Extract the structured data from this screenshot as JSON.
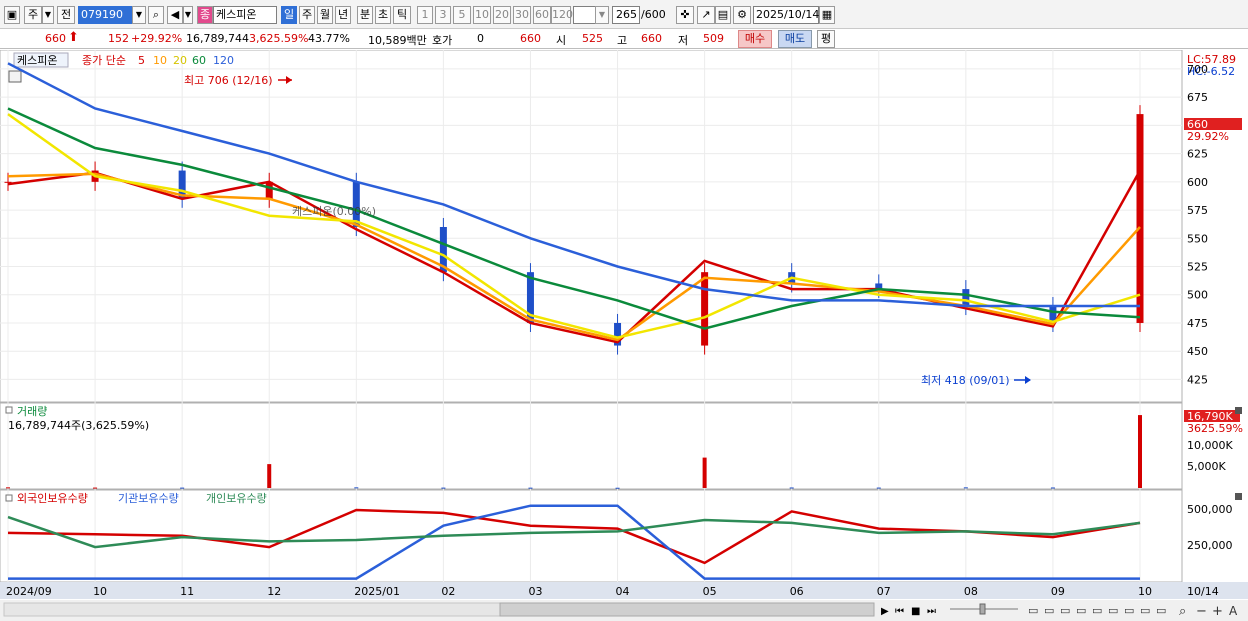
{
  "toolbar": {
    "period_label": "주",
    "prev_label": "전",
    "code_value": "079190",
    "badge_label": "종",
    "stock_name": "케스피온",
    "periods": [
      "일",
      "주",
      "월",
      "년",
      "분",
      "초",
      "틱"
    ],
    "numbers": [
      "1",
      "3",
      "5",
      "10",
      "20",
      "30",
      "60",
      "120"
    ],
    "count_value": "265",
    "count_total": "/600",
    "date_value": "2025/10/14"
  },
  "quote": {
    "price": "660",
    "change": "152",
    "change_pct": "+29.92%",
    "volume": "16,789,744",
    "volume_pct": "3,625.59%",
    "turnover_pct": "43.77%",
    "amount": "10,589백만",
    "hoga_label": "호가",
    "hoga_value": "0",
    "hoga_price": "660",
    "open_label": "시",
    "open_value": "525",
    "high_label": "고",
    "high_value": "660",
    "low_label": "저",
    "low_value": "509",
    "buy_label": "매수",
    "sell_label": "매도",
    "avg_label": "평"
  },
  "price_pane": {
    "name": "케스피온",
    "ma_title": "종가 단순",
    "ma_periods": [
      "5",
      "10",
      "20",
      "60",
      "120"
    ],
    "ma_colors": [
      "#d40000",
      "#ff9a00",
      "#f2e600",
      "#0b8a3b",
      "#2b5fd9"
    ],
    "lc_label": "LC:57.89",
    "hc_label": "HC:-6.52",
    "high_annotation": "최고 706 (12/16)",
    "low_annotation": "최저 418 (09/01)",
    "current_tag": "660",
    "current_pct": "29.92%",
    "watermark": "케스피온(0.00%)",
    "y_ticks": [
      "700",
      "675",
      "650",
      "625",
      "600",
      "575",
      "550",
      "525",
      "500",
      "475",
      "450",
      "425"
    ]
  },
  "volume_pane": {
    "title": "거래량",
    "value_label": "16,789,744주(3,625.59%)",
    "current_tag": "16,790K",
    "current_pct": "3625.59%",
    "y_ticks": [
      "10,000K",
      "5,000K"
    ]
  },
  "holding_pane": {
    "foreign_label": "외국인보유수량",
    "inst_label": "기관보유수량",
    "indiv_label": "개인보유수량",
    "y_ticks": [
      "500,000",
      "250,000"
    ]
  },
  "x_axis": {
    "labels": [
      "2024/09",
      "10",
      "11",
      "12",
      "2025/01",
      "02",
      "03",
      "04",
      "05",
      "06",
      "07",
      "08",
      "09",
      "10"
    ],
    "end_label": "10/14"
  },
  "chart_data": [
    {
      "type": "candlestick",
      "title": "케스피온",
      "x": [
        "2024/09",
        "2024/10",
        "2024/11",
        "2024/12",
        "2025/01",
        "2025/02",
        "2025/03",
        "2025/04",
        "2025/05",
        "2025/06",
        "2025/07",
        "2025/08",
        "2025/09",
        "2025/10"
      ],
      "close": [
        600,
        610,
        585,
        600,
        560,
        520,
        475,
        455,
        520,
        510,
        505,
        490,
        475,
        660
      ],
      "high_marker": 706,
      "low_marker": 418,
      "ylim": [
        405,
        715
      ],
      "series": [
        {
          "name": "5",
          "color": "#d40000",
          "values": [
            598,
            608,
            585,
            600,
            558,
            520,
            475,
            458,
            530,
            505,
            505,
            488,
            472,
            610
          ]
        },
        {
          "name": "10",
          "color": "#ff9a00",
          "values": [
            605,
            607,
            588,
            585,
            562,
            525,
            478,
            460,
            515,
            510,
            503,
            490,
            474,
            560
          ]
        },
        {
          "name": "20",
          "color": "#f2e600",
          "values": [
            660,
            605,
            592,
            570,
            565,
            535,
            482,
            462,
            480,
            515,
            500,
            495,
            476,
            500
          ]
        },
        {
          "name": "60",
          "color": "#0b8a3b",
          "values": [
            665,
            630,
            615,
            595,
            575,
            545,
            515,
            495,
            470,
            490,
            505,
            500,
            485,
            480
          ]
        },
        {
          "name": "120",
          "color": "#2b5fd9",
          "values": [
            705,
            665,
            645,
            625,
            600,
            580,
            550,
            525,
            505,
            495,
            495,
            490,
            490,
            490
          ]
        }
      ]
    },
    {
      "type": "bar",
      "title": "거래량",
      "x": [
        "2024/09",
        "2024/10",
        "2024/11",
        "2024/12",
        "2025/01",
        "2025/02",
        "2025/03",
        "2025/04",
        "2025/05",
        "2025/06",
        "2025/07",
        "2025/08",
        "2025/09",
        "2025/10"
      ],
      "values": [
        150,
        100,
        90,
        5500,
        150,
        90,
        80,
        60,
        7000,
        120,
        100,
        150,
        120,
        16790
      ],
      "ylim": [
        0,
        17500
      ]
    },
    {
      "type": "line",
      "title": "보유수량",
      "x": [
        "2024/09",
        "2024/10",
        "2024/11",
        "2024/12",
        "2025/01",
        "2025/02",
        "2025/03",
        "2025/04",
        "2025/05",
        "2025/06",
        "2025/07",
        "2025/08",
        "2025/09",
        "2025/10"
      ],
      "ylim": [
        0,
        560000
      ],
      "series": [
        {
          "name": "외국인보유수량",
          "color": "#d40000",
          "values": [
            330000,
            320000,
            310000,
            230000,
            490000,
            470000,
            380000,
            360000,
            120000,
            480000,
            360000,
            340000,
            300000,
            400000
          ]
        },
        {
          "name": "기관보유수량",
          "color": "#2b5fd9",
          "values": [
            10000,
            10000,
            10000,
            10000,
            10000,
            380000,
            520000,
            520000,
            10000,
            10000,
            10000,
            10000,
            10000,
            10000
          ]
        },
        {
          "name": "개인보유수량",
          "color": "#2e8b57",
          "values": [
            440000,
            230000,
            300000,
            270000,
            280000,
            310000,
            330000,
            340000,
            420000,
            400000,
            330000,
            340000,
            320000,
            400000
          ]
        }
      ]
    }
  ]
}
